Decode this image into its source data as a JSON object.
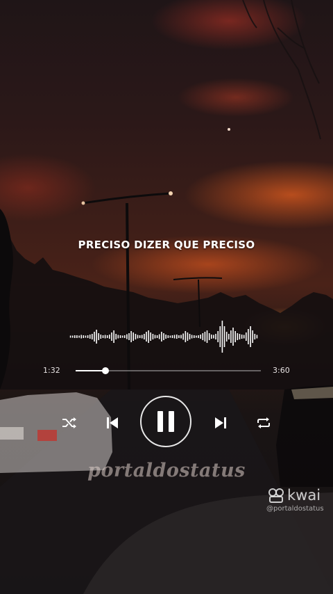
{
  "lyric": "PRECISO DIZER QUE PRECISO",
  "player": {
    "current_time": "1:32",
    "total_time": "3:60",
    "progress": 0.16,
    "state": "playing",
    "waveform_heights": [
      3,
      3,
      4,
      4,
      3,
      5,
      4,
      3,
      4,
      6,
      8,
      14,
      20,
      10,
      6,
      4,
      5,
      4,
      6,
      12,
      18,
      8,
      5,
      4,
      3,
      4,
      7,
      10,
      16,
      12,
      8,
      5,
      4,
      5,
      8,
      14,
      18,
      12,
      8,
      5,
      4,
      7,
      14,
      10,
      6,
      4,
      3,
      4,
      5,
      6,
      4,
      5,
      9,
      16,
      12,
      8,
      5,
      4,
      3,
      4,
      6,
      10,
      14,
      18,
      10,
      6,
      5,
      8,
      16,
      30,
      46,
      30,
      14,
      8,
      18,
      26,
      16,
      10,
      8,
      6,
      5,
      12,
      22,
      30,
      18,
      8,
      5
    ]
  },
  "controls": {
    "shuffle_icon": "shuffle-icon",
    "previous_icon": "skip-previous-icon",
    "pause_icon": "pause-icon",
    "next_icon": "skip-next-icon",
    "repeat_icon": "repeat-icon"
  },
  "watermark": "portaldostatus",
  "kwai": {
    "logo_text": "kwai",
    "handle": "@portaldostatus"
  },
  "colors": {
    "accent": "#ffffff",
    "sky_glow": "#d65a22",
    "background_dark": "#131112"
  }
}
